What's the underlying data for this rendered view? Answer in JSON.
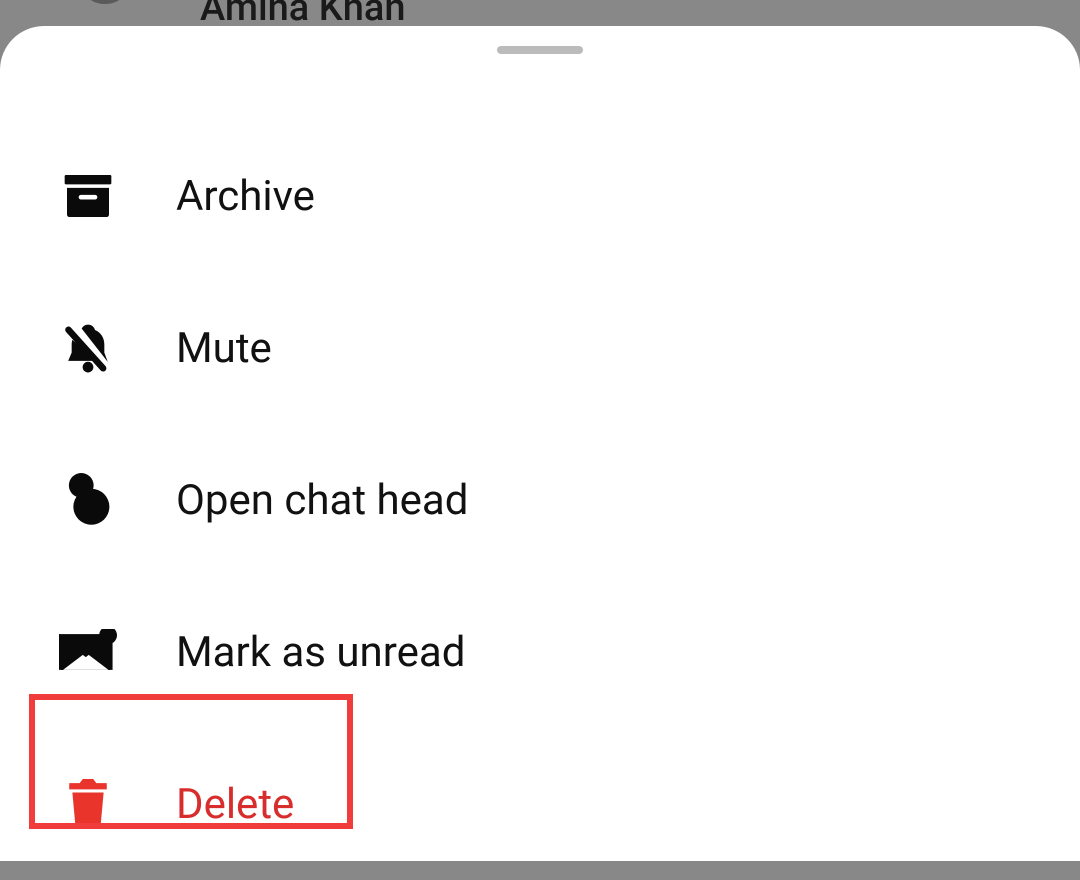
{
  "backdrop": {
    "contact_name": "Amina Khan"
  },
  "menu": {
    "archive": {
      "label": "Archive"
    },
    "mute": {
      "label": "Mute"
    },
    "open_chat_head": {
      "label": "Open chat head"
    },
    "mark_unread": {
      "label": "Mark as unread"
    },
    "delete": {
      "label": "Delete"
    }
  },
  "colors": {
    "delete": "#d82d2d",
    "highlight_border": "#f13c3c"
  }
}
